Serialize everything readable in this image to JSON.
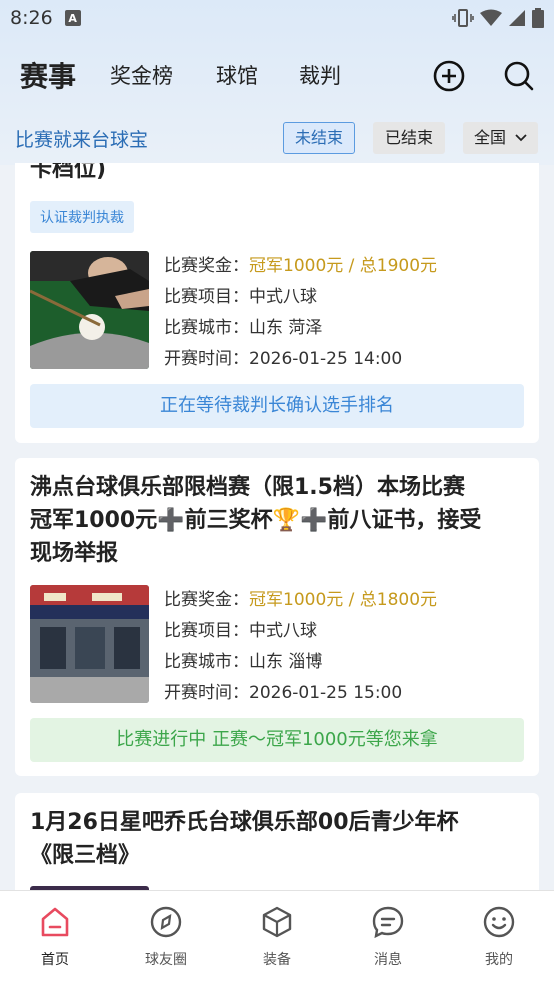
{
  "status_bar": {
    "time": "8:26",
    "notice_glyph": "A"
  },
  "nav": {
    "tabs": [
      {
        "label": "赛事",
        "active": true
      },
      {
        "label": "奖金榜",
        "active": false
      },
      {
        "label": "球馆",
        "active": false
      },
      {
        "label": "裁判",
        "active": false
      }
    ],
    "add_icon": "add-circle-icon",
    "search_icon": "search-icon"
  },
  "subbar": {
    "slogan": "比赛就来台球宝",
    "filter_unfinished": "未结束",
    "filter_finished": "已结束",
    "region": "全国"
  },
  "colors": {
    "accent": "#3a86d6",
    "gold": "#c69a1d",
    "green": "#3ca64a"
  },
  "cards": [
    {
      "title": "卡档位)",
      "tag": "认证裁判执裁",
      "prize_label": "比赛奖金：",
      "prize_value": "冠军1000元 / 总1900元",
      "event_label": "比赛项目：",
      "event_value": "中式八球",
      "city_label": "比赛城市：",
      "city_value": "山东 菏泽",
      "time_label": "开赛时间：",
      "time_value": "2026-01-25 14:00",
      "status": "正在等待裁判长确认选手排名"
    },
    {
      "title_lines": [
        "沸点台球俱乐部限档赛（限1.5档）本场比赛",
        "冠军1000元➕前三奖杯🏆➕前八证书，接受",
        "现场举报"
      ],
      "prize_label": "比赛奖金：",
      "prize_value": "冠军1000元 / 总1800元",
      "event_label": "比赛项目：",
      "event_value": "中式八球",
      "city_label": "比赛城市：",
      "city_value": "山东 淄博",
      "time_label": "开赛时间：",
      "time_value": "2026-01-25 15:00",
      "status": "比赛进行中 正赛～冠军1000元等您来拿"
    },
    {
      "title_lines": [
        "1月26日星吧乔氏台球俱乐部00后青少年杯",
        "《限三档》"
      ]
    }
  ],
  "tabbar": {
    "items": [
      {
        "label": "首页",
        "icon": "home-icon"
      },
      {
        "label": "球友圈",
        "icon": "compass-icon"
      },
      {
        "label": "装备",
        "icon": "box-icon"
      },
      {
        "label": "消息",
        "icon": "chat-icon"
      },
      {
        "label": "我的",
        "icon": "smile-icon"
      }
    ]
  }
}
